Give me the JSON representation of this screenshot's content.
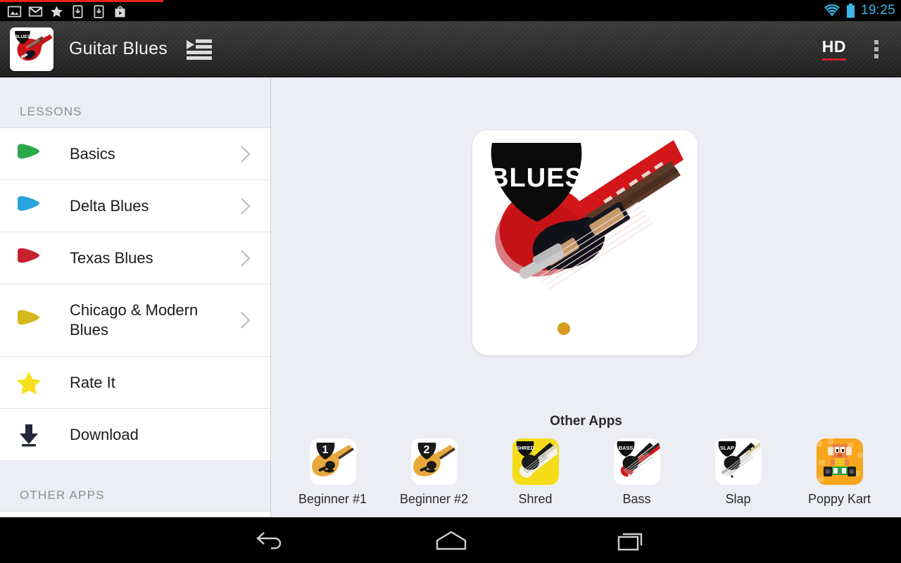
{
  "status_bar": {
    "notifications": [
      "photo-icon",
      "gmail-icon",
      "star-icon",
      "download-icon",
      "download-icon",
      "play-store-icon"
    ],
    "time": "19:25",
    "wifi": "wifi-icon",
    "battery": "battery-icon",
    "clock_color": "#3ab6e8",
    "progress_color": "#e8201a"
  },
  "action_bar": {
    "app_icon": "guitar-blues-app-icon",
    "title": "Guitar Blues",
    "drawer_toggle": "list-indent-icon",
    "hd_label": "HD",
    "hd_underline_color": "#cf2127",
    "overflow": "overflow-menu-icon"
  },
  "sidebar": {
    "sections": [
      {
        "header": "LESSONS",
        "items": [
          {
            "label": "Basics",
            "icon": "guitar-pick-icon",
            "color": "#2aa84a",
            "chevron": true
          },
          {
            "label": "Delta Blues",
            "icon": "guitar-pick-icon",
            "color": "#28a3dd",
            "chevron": true
          },
          {
            "label": "Texas Blues",
            "icon": "guitar-pick-icon",
            "color": "#c8202f",
            "chevron": true
          },
          {
            "label": "Chicago & Modern Blues",
            "icon": "guitar-pick-icon",
            "color": "#d4b81c",
            "chevron": true
          },
          {
            "label": "Rate It",
            "icon": "star-icon",
            "color": "#f5e11e",
            "chevron": false
          },
          {
            "label": "Download",
            "icon": "download-arrow-icon",
            "color": "#232838",
            "chevron": false
          }
        ]
      },
      {
        "header": "OTHER APPS",
        "items": []
      }
    ]
  },
  "content": {
    "hero": {
      "icon": "guitar-blues-hero-icon",
      "pick_text": "BLUES"
    },
    "other_apps_title": "Other Apps",
    "apps": [
      {
        "name": "Beginner #1",
        "icon": "beginner-1-app-icon",
        "badge": "1"
      },
      {
        "name": "Beginner #2",
        "icon": "beginner-2-app-icon",
        "badge": "2"
      },
      {
        "name": "Shred",
        "icon": "shred-app-icon",
        "badge": "SHRED"
      },
      {
        "name": "Bass",
        "icon": "bass-app-icon",
        "badge": "BASS"
      },
      {
        "name": "Slap",
        "icon": "slap-app-icon",
        "badge": "SLAP"
      },
      {
        "name": "Poppy Kart",
        "icon": "poppy-kart-app-icon",
        "badge": ""
      }
    ]
  },
  "nav_bar": {
    "back": "back-icon",
    "home": "home-icon",
    "recents": "recent-apps-icon"
  }
}
